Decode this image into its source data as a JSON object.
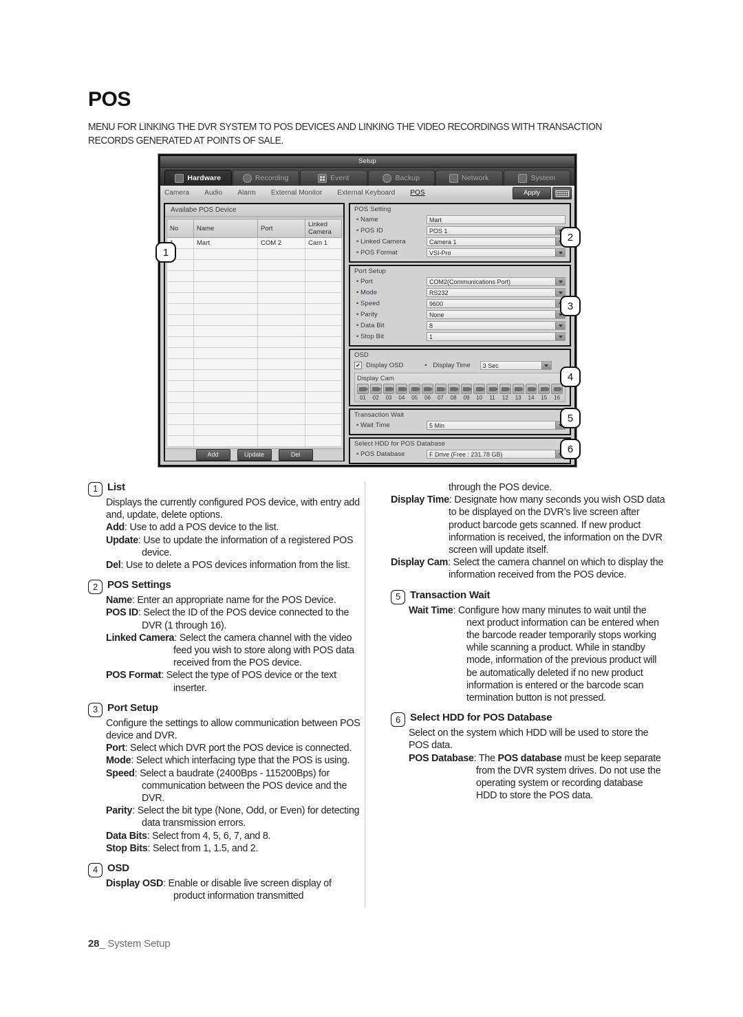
{
  "page": {
    "title": "POS",
    "intro": "MENU FOR LINKING THE DVR SYSTEM TO POS DEVICES AND LINKING THE VIDEO RECORDINGS WITH TRANSACTION RECORDS GENERATED AT POINTS OF SALE.",
    "footer_page": "28",
    "footer_label": "_ System Setup"
  },
  "dvr": {
    "window_title": "Setup",
    "tabs": [
      {
        "label": "Hardware",
        "icon": "hardware-icon",
        "active": true
      },
      {
        "label": "Recording",
        "icon": "recording-icon",
        "active": false
      },
      {
        "label": "Event",
        "icon": "event-icon",
        "active": false
      },
      {
        "label": "Backup",
        "icon": "backup-icon",
        "active": false
      },
      {
        "label": "Network",
        "icon": "network-icon",
        "active": false
      },
      {
        "label": "System",
        "icon": "system-icon",
        "active": false
      }
    ],
    "subtabs": [
      {
        "label": "Camera",
        "current": false
      },
      {
        "label": "Audio",
        "current": false
      },
      {
        "label": "Alarm",
        "current": false
      },
      {
        "label": "External Monitor",
        "current": false
      },
      {
        "label": "External Keyboard",
        "current": false
      },
      {
        "label": "POS",
        "current": true
      }
    ],
    "apply_label": "Apply",
    "keyboard_icon": "virtual-keyboard-icon",
    "device_list": {
      "caption": "Availabe POS Device",
      "columns": [
        "No",
        "Name",
        "Port",
        "Linked Camera"
      ],
      "rows": [
        [
          "1",
          "Mart",
          "COM 2",
          "Cam 1"
        ]
      ],
      "empty_rows": 12,
      "buttons": [
        "Add",
        "Update",
        "Del"
      ]
    },
    "pos_setting": {
      "legend": "POS Setting",
      "fields": [
        {
          "label": "Name",
          "value": "Mart",
          "type": "text"
        },
        {
          "label": "POS ID",
          "value": "POS 1",
          "type": "select"
        },
        {
          "label": "Linked Camera",
          "value": "Camera 1",
          "type": "select"
        },
        {
          "label": "POS Format",
          "value": "VSI-Pro",
          "type": "select"
        }
      ]
    },
    "port_setup": {
      "legend": "Port Setup",
      "fields": [
        {
          "label": "Port",
          "value": "COM2(Communications Port)",
          "type": "select"
        },
        {
          "label": "Mode",
          "value": "RS232",
          "type": "select"
        },
        {
          "label": "Speed",
          "value": "9600",
          "type": "select"
        },
        {
          "label": "Parity",
          "value": "None",
          "type": "select"
        },
        {
          "label": "Data Bit",
          "value": "8",
          "type": "select"
        },
        {
          "label": "Stop Bit",
          "value": "1",
          "type": "select"
        }
      ]
    },
    "osd": {
      "legend": "OSD",
      "display_osd_label": "Display OSD",
      "display_osd_checked": "✔",
      "display_time_label": "Display Time",
      "display_time_value": "3 Sec",
      "display_cam_caption": "Display Cam",
      "cameras": [
        "01",
        "02",
        "03",
        "04",
        "05",
        "06",
        "07",
        "08",
        "09",
        "10",
        "11",
        "12",
        "13",
        "14",
        "15",
        "16"
      ]
    },
    "transaction_wait": {
      "legend": "Transaction Wait",
      "label": "Wait Time",
      "value": "5 Min"
    },
    "hdd_database": {
      "legend": "Select HDD for POS Database",
      "label": "POS Database",
      "value": "F Drive (Free : 231.78 GB)"
    },
    "callouts": [
      "1",
      "2",
      "3",
      "4",
      "5",
      "6"
    ]
  },
  "sections": {
    "s1": {
      "num": "1",
      "head": "List",
      "p1": "Displays the currently configured POS device, with entry add and, update, delete options.",
      "add_term": "Add",
      "add_text": ": Use to add a POS device to the list.",
      "update_term": "Update",
      "update_text": ": Use to update the information of a registered POS device.",
      "del_term": "Del",
      "del_text": ": Use to delete a POS devices information from the list."
    },
    "s2": {
      "num": "2",
      "head": "POS Settings",
      "name_term": "Name",
      "name_text": ": Enter an appropriate name for the POS Device.",
      "posid_term": "POS ID",
      "posid_text": ": Select the ID of the POS device connected to the DVR (1 through 16).",
      "cam_term": "Linked Camera",
      "cam_text": ": Select the camera channel with the video feed you wish to store along with POS data received from the POS device.",
      "fmt_term": "POS Format",
      "fmt_text": ": Select the type of POS device or the text inserter."
    },
    "s3": {
      "num": "3",
      "head": "Port Setup",
      "p1": "Configure the settings to allow communication between POS device and DVR.",
      "port_term": "Port",
      "port_text": ": Select which DVR port the POS device is connected.",
      "mode_term": "Mode",
      "mode_text": ": Select which interfacing type that the POS is using.",
      "speed_term": "Speed",
      "speed_text": ": Select a baudrate (2400Bps - 115200Bps) for communication between the POS device and the DVR.",
      "parity_term": "Parity",
      "parity_text": ": Select the bit type (None, Odd, or Even) for detecting data transmission errors.",
      "databits_term": "Data Bits",
      "databits_text": ": Select from 4, 5, 6, 7, and 8.",
      "stopbits_term": "Stop Bits",
      "stopbits_text": ": Select from 1, 1.5, and 2."
    },
    "s4": {
      "num": "4",
      "head": "OSD",
      "osd_term": "Display OSD",
      "osd_text": ": Enable or disable live screen display of product information transmitted",
      "osd_cont": "through the POS device.",
      "time_term": "Display Time",
      "time_text": ": Designate how many seconds you wish OSD data to be displayed on the DVR’s live screen after product barcode gets scanned. If new product information is received, the information on the DVR screen will update itself.",
      "cam_term": "Display Cam",
      "cam_text": ": Select the camera channel on which to display the information received from the POS device."
    },
    "s5": {
      "num": "5",
      "head": "Transaction Wait",
      "wait_term": "Wait Time",
      "wait_text": ": Configure how many minutes to wait until the next product information can be entered when the barcode reader temporarily stops working while scanning a product. While in standby mode, information of the previous product will be automatically deleted if no new product information is entered or the barcode scan termination button is not pressed."
    },
    "s6": {
      "num": "6",
      "head": "Select HDD for POS Database",
      "p1": "Select on the system which HDD will be used to store the POS data.",
      "db_term": "POS Database",
      "db_text_a": ": The ",
      "db_bold": "POS database",
      "db_text_b": " must be keep separate from the DVR system drives. Do not use the operating system or recording database HDD to store the POS data."
    }
  }
}
